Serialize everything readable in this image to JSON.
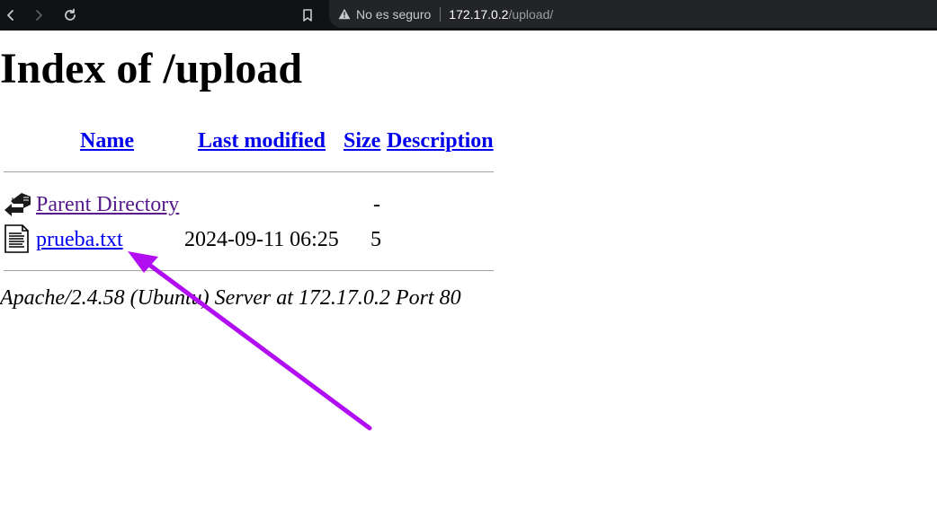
{
  "browser": {
    "back_icon": "chevron-left-icon",
    "forward_icon": "chevron-right-icon",
    "reload_icon": "reload-icon",
    "bookmark_icon": "bookmark-icon",
    "security_icon": "warning-triangle-icon",
    "security_label": "No es seguro",
    "url_host": "172.17.0.2",
    "url_path": "/upload/"
  },
  "page": {
    "title": "Index of /upload",
    "columns": {
      "name": "Name",
      "last_modified": "Last modified",
      "size": "Size",
      "description": "Description"
    },
    "rows": [
      {
        "icon": "back-folder-icon",
        "name": "Parent Directory",
        "last_modified": "",
        "size": "-",
        "description": "",
        "visited": true
      },
      {
        "icon": "text-file-icon",
        "name": "prueba.txt",
        "last_modified": "2024-09-11 06:25",
        "size": "5",
        "description": "",
        "visited": false
      }
    ],
    "footer": "Apache/2.4.58 (Ubuntu) Server at 172.17.0.2 Port 80"
  },
  "annotation": {
    "color": "#b10ff2",
    "icon": "arrow-pointer-icon"
  }
}
